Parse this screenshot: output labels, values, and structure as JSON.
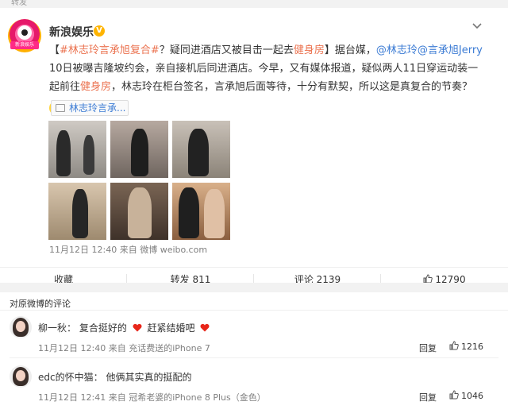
{
  "top_cut_text": "转发",
  "post": {
    "author": "新浪娱乐",
    "verified_badge": "V",
    "avatar_tag": "新浪娱乐",
    "more_icon": "chevron-down-icon",
    "text": {
      "p1": "【",
      "topic": "#林志玲言承旭复合#",
      "p2": "？疑同进酒店又被目击一起去",
      "gym1": "健身房",
      "p3": "】据台媒，",
      "mention1": "@林志玲",
      "mention2": "@言承旭Jerry",
      "p4": " 10日被曝吉隆坡约会，亲自接机后同进酒店。今早，又有媒体报道，疑似两人11日穿运动装一起前往",
      "gym2": "健身房",
      "p5": "，林志玲在柜台签名，言承旭后面等待，十分有默契，所以这是真复合的节奏？",
      "emoji": "😮"
    },
    "topic_pill": "林志玲言承...",
    "meta": {
      "time": "11月12日 12:40",
      "from_label": "来自",
      "source": "微博 weibo.com"
    },
    "actions": {
      "collect": "收藏",
      "repost": "转发 811",
      "comment": "评论 2139",
      "like": "12790"
    }
  },
  "comments": {
    "header": "对原微博的评论",
    "items": [
      {
        "user": "柳一秋",
        "sep": "：",
        "text_a": "复合挺好的",
        "text_b": "赶紧结婚吧",
        "time": "11月12日 12:40",
        "from_label": "来自",
        "device": "充话费送的iPhone 7",
        "reply": "回复",
        "likes": "1216"
      },
      {
        "user": "edc的怀中猫",
        "sep": "：",
        "text_a": "他俩其实真的挺配的",
        "time": "11月12日 12:41",
        "from_label": "来自",
        "device": "冠希老婆的iPhone 8 Plus（金色）",
        "reply": "回复",
        "likes": "1046"
      }
    ]
  },
  "colors": {
    "link_orange": "#eb7350",
    "mention_blue": "#3b7bd4",
    "heart_red": "#e8261a",
    "badge_gold": "#ffb400"
  }
}
